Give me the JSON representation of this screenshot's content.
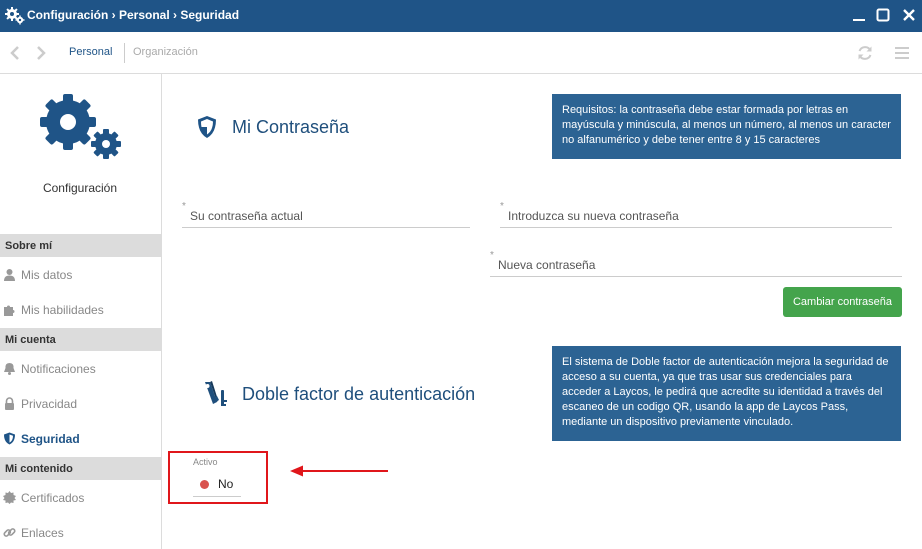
{
  "titlebar": {
    "title": "Configuración › Personal › Seguridad",
    "icons": [
      "gear-icon",
      "minimize-icon",
      "maximize-icon",
      "close-icon"
    ]
  },
  "toolbar": {
    "tabs": [
      {
        "label": "Personal",
        "active": true
      },
      {
        "label": "Organización",
        "active": false
      }
    ],
    "icons": [
      "chevron-left-icon",
      "chevron-right-icon",
      "refresh-icon",
      "menu-icon"
    ]
  },
  "sidebar": {
    "title": "Configuración",
    "sections": [
      {
        "label": "Sobre mí",
        "items": [
          {
            "label": "Mis datos",
            "icon": "user-icon"
          },
          {
            "label": "Mis habilidades",
            "icon": "puzzle-icon"
          }
        ]
      },
      {
        "label": "Mi cuenta",
        "items": [
          {
            "label": "Notificaciones",
            "icon": "bell-icon"
          },
          {
            "label": "Privacidad",
            "icon": "lock-icon"
          },
          {
            "label": "Seguridad",
            "icon": "shield-icon",
            "active": true
          }
        ]
      },
      {
        "label": "Mi contenido",
        "items": [
          {
            "label": "Certificados",
            "icon": "certificate-icon"
          },
          {
            "label": "Enlaces",
            "icon": "link-icon"
          }
        ]
      }
    ]
  },
  "password": {
    "title": "Mi Contraseña",
    "info": "Requisitos: la contraseña debe estar formada por letras en mayúscula y minúscula, al menos un número, al menos un caracter no alfanumérico y debe tener entre 8 y 15 caracteres",
    "current_placeholder": "Su contraseña actual",
    "new_placeholder": "Introduzca su nueva contraseña",
    "repeat_placeholder": "Nueva contraseña",
    "required_mark": "*",
    "button": "Cambiar contraseña"
  },
  "twofactor": {
    "title": "Doble factor de autenticación",
    "info": "El sistema de Doble factor de autenticación mejora la seguridad de acceso a su cuenta, ya que tras usar sus credenciales para acceder a Laycos, le pedirá que acredite su identidad a través del escaneo de un codigo QR, usando la app de Laycos Pass, mediante un dispositivo previamente vinculado.",
    "active_label": "Activo",
    "active_value": "No"
  },
  "colors": {
    "brand": "#1f5487",
    "info_box": "#2c6393",
    "button_green": "#44a44c",
    "highlight_red": "#e0161b",
    "status_red": "#d9534f"
  }
}
